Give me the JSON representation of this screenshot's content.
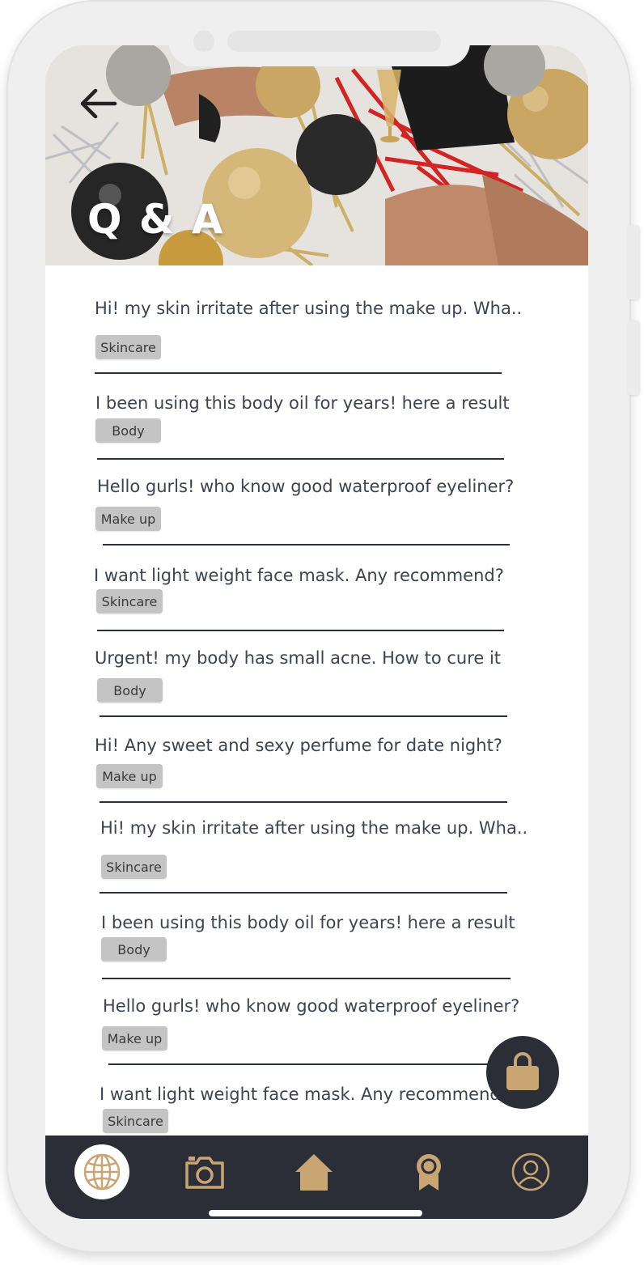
{
  "hero": {
    "title": "Q & A"
  },
  "questions": [
    {
      "text": "Hi! my skin irritate after using the make up. Wha..",
      "tag": "Skincare"
    },
    {
      "text": "I been using this body oil for years! here a result",
      "tag": "Body"
    },
    {
      "text": "Hello gurls! who know good waterproof eyeliner?",
      "tag": "Make up"
    },
    {
      "text": "I want light weight face mask. Any recommend?",
      "tag": "Skincare"
    },
    {
      "text": "Urgent! my body has small acne. How to cure it",
      "tag": "Body"
    },
    {
      "text": "Hi! Any sweet and sexy perfume for date night?",
      "tag": "Make up"
    },
    {
      "text": "Hi! my skin irritate after using the make up. Wha..",
      "tag": "Skincare"
    },
    {
      "text": "I been using this body oil for years! here a result",
      "tag": "Body"
    },
    {
      "text": "Hello gurls! who know good waterproof eyeliner?",
      "tag": "Make up"
    },
    {
      "text": "I want light weight face mask. Any recommend?",
      "tag": "Skincare"
    }
  ],
  "nav": {
    "items": [
      {
        "icon": "globe-icon",
        "active": true
      },
      {
        "icon": "camera-icon",
        "active": false
      },
      {
        "icon": "home-icon",
        "active": false
      },
      {
        "icon": "award-icon",
        "active": false
      },
      {
        "icon": "profile-icon",
        "active": false
      }
    ]
  },
  "fab": {
    "icon": "shopping-bag-icon"
  },
  "colors": {
    "accent": "#c8a572",
    "dark": "#2b2e36",
    "tag_bg": "#c4c4c4",
    "text": "#3d4350"
  }
}
